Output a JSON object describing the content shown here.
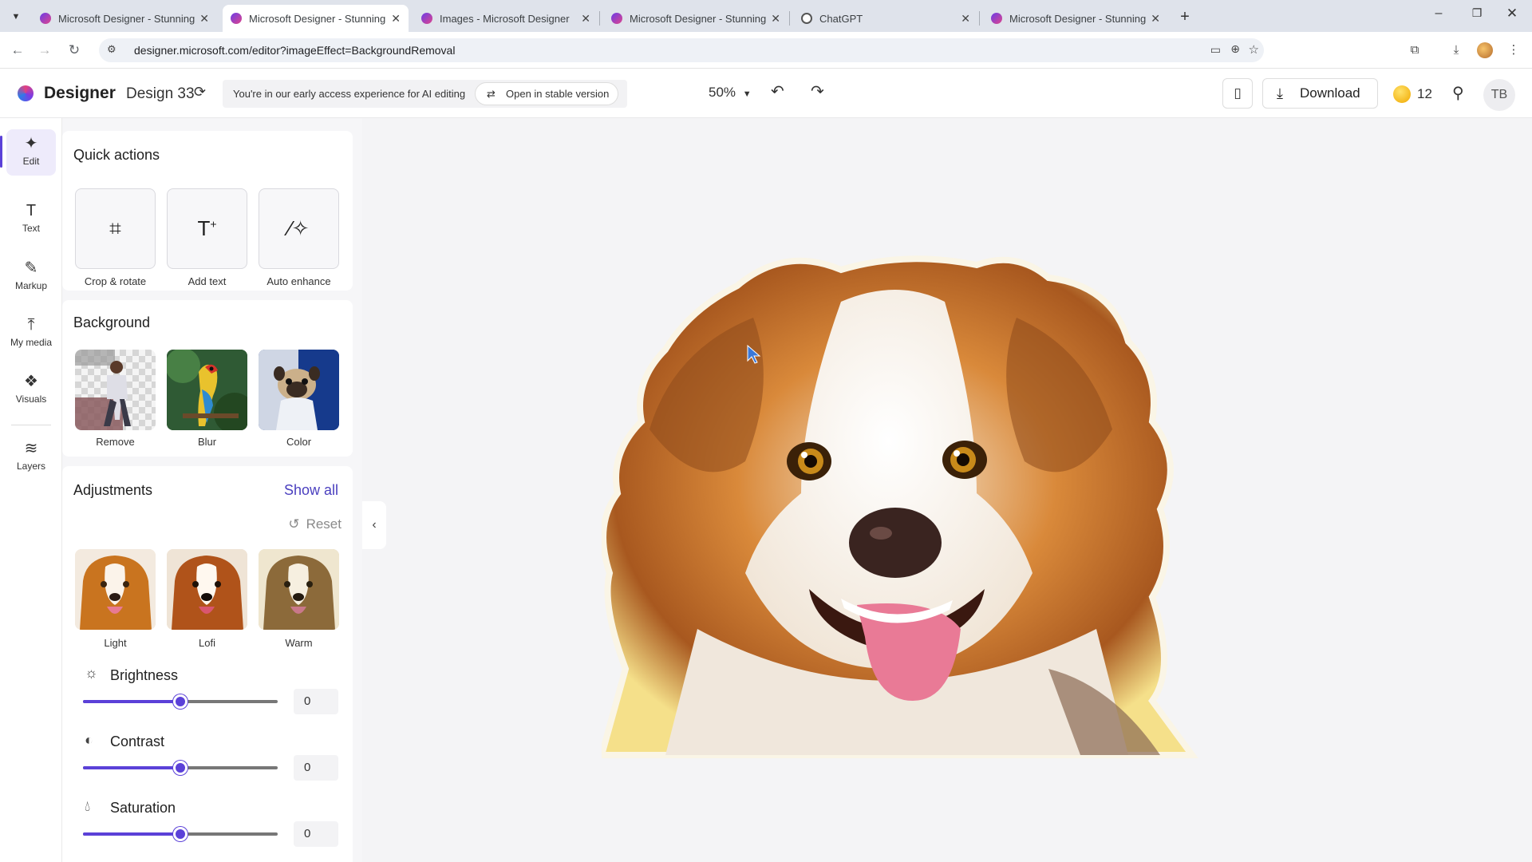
{
  "browser": {
    "tabs": [
      {
        "title": "Microsoft Designer - Stunning",
        "active": false
      },
      {
        "title": "Microsoft Designer - Stunning",
        "active": true
      },
      {
        "title": "Images - Microsoft Designer",
        "active": false
      },
      {
        "title": "Microsoft Designer - Stunning",
        "active": false
      },
      {
        "title": "ChatGPT",
        "active": false
      },
      {
        "title": "Microsoft Designer - Stunning",
        "active": false
      }
    ],
    "url": "designer.microsoft.com/editor?imageEffect=BackgroundRemoval",
    "tab_close": "✕",
    "new_tab": "+"
  },
  "appbar": {
    "brand": "Designer",
    "design_name": "Design 33",
    "banner_text": "You're in our early access experience for AI editing",
    "stable_button": "Open in stable version",
    "zoom": "50%",
    "download": "Download",
    "credits": "12",
    "avatar": "TB"
  },
  "rail": {
    "items": [
      {
        "label": "Edit",
        "icon": "edit-sparkle-icon",
        "active": true
      },
      {
        "label": "Text",
        "icon": "text-icon"
      },
      {
        "label": "Markup",
        "icon": "pen-icon"
      },
      {
        "label": "My media",
        "icon": "upload-icon"
      },
      {
        "label": "Visuals",
        "icon": "shapes-icon"
      },
      {
        "label": "Layers",
        "icon": "layers-icon"
      }
    ]
  },
  "quick_actions": {
    "title": "Quick actions",
    "items": [
      {
        "label": "Crop & rotate",
        "icon": "crop-icon"
      },
      {
        "label": "Add text",
        "icon": "add-text-icon"
      },
      {
        "label": "Auto enhance",
        "icon": "magic-wand-icon"
      }
    ]
  },
  "background": {
    "title": "Background",
    "items": [
      {
        "label": "Remove"
      },
      {
        "label": "Blur"
      },
      {
        "label": "Color"
      }
    ]
  },
  "adjustments": {
    "title": "Adjustments",
    "show_all": "Show all",
    "reset": "Reset",
    "presets": [
      {
        "label": "Light"
      },
      {
        "label": "Lofi"
      },
      {
        "label": "Warm"
      }
    ],
    "sliders": [
      {
        "label": "Brightness",
        "value": "0",
        "level": 0.5,
        "icon": "sun-icon"
      },
      {
        "label": "Contrast",
        "value": "0",
        "level": 0.5,
        "icon": "contrast-icon"
      },
      {
        "label": "Saturation",
        "value": "0",
        "level": 0.5,
        "icon": "droplet-icon"
      }
    ]
  },
  "colors": {
    "accent": "#5b41d8",
    "tab_strip": "#dfe3eb",
    "canvas_bg": "#f4f4f6",
    "panel_bg": "#f6f6f8"
  }
}
